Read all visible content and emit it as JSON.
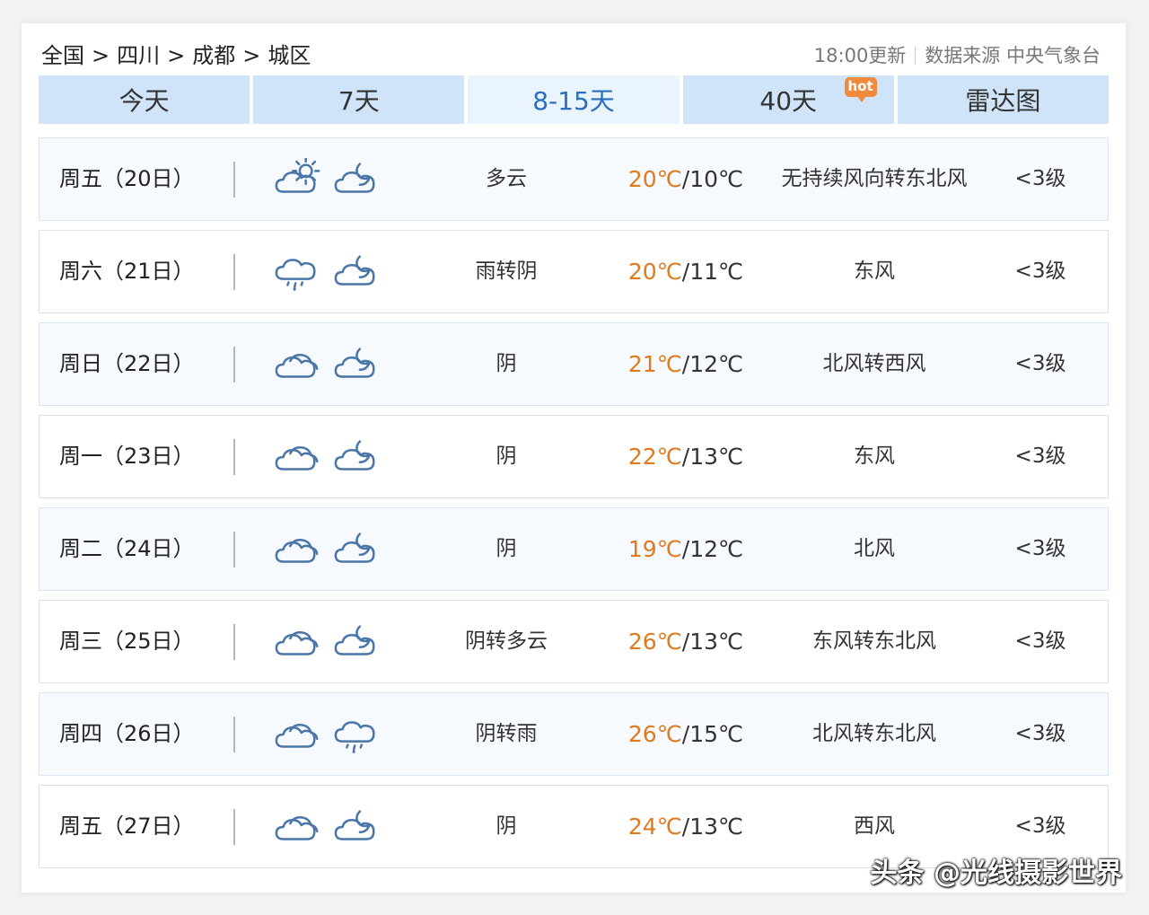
{
  "breadcrumb": [
    "全国",
    "四川",
    "成都",
    "城区"
  ],
  "breadcrumb_separator": ">",
  "update_time": "18:00更新",
  "source_label": "数据来源 中央气象台",
  "tabs": [
    {
      "label": "今天",
      "active": false
    },
    {
      "label": "7天",
      "active": false
    },
    {
      "label": "8-15天",
      "active": true
    },
    {
      "label": "40天",
      "active": false,
      "badge": "hot"
    },
    {
      "label": "雷达图",
      "active": false
    }
  ],
  "forecast": [
    {
      "day": "周五（20日）",
      "icons": [
        "partly-cloudy-day-icon",
        "cloudy-night-icon"
      ],
      "desc": "多云",
      "high": "20℃",
      "low": "10℃",
      "wind": "无持续风向转东北风",
      "level": "<3级"
    },
    {
      "day": "周六（21日）",
      "icons": [
        "rain-cloud-icon",
        "cloudy-night-icon"
      ],
      "desc": "雨转阴",
      "high": "20℃",
      "low": "11℃",
      "wind": "东风",
      "level": "<3级"
    },
    {
      "day": "周日（22日）",
      "icons": [
        "overcast-icon",
        "cloudy-night-icon"
      ],
      "desc": "阴",
      "high": "21℃",
      "low": "12℃",
      "wind": "北风转西风",
      "level": "<3级"
    },
    {
      "day": "周一（23日）",
      "icons": [
        "overcast-icon",
        "cloudy-night-icon"
      ],
      "desc": "阴",
      "high": "22℃",
      "low": "13℃",
      "wind": "东风",
      "level": "<3级"
    },
    {
      "day": "周二（24日）",
      "icons": [
        "overcast-icon",
        "cloudy-night-icon"
      ],
      "desc": "阴",
      "high": "19℃",
      "low": "12℃",
      "wind": "北风",
      "level": "<3级"
    },
    {
      "day": "周三（25日）",
      "icons": [
        "overcast-icon",
        "cloudy-night-icon"
      ],
      "desc": "阴转多云",
      "high": "26℃",
      "low": "13℃",
      "wind": "东风转东北风",
      "level": "<3级"
    },
    {
      "day": "周四（26日）",
      "icons": [
        "overcast-icon",
        "rain-cloud-icon"
      ],
      "desc": "阴转雨",
      "high": "26℃",
      "low": "15℃",
      "wind": "北风转东北风",
      "level": "<3级"
    },
    {
      "day": "周五（27日）",
      "icons": [
        "overcast-icon",
        "cloudy-night-icon"
      ],
      "desc": "阴",
      "high": "24℃",
      "low": "13℃",
      "wind": "西风",
      "level": "<3级"
    }
  ],
  "temp_separator": "/",
  "watermark": "头条 @光线摄影世界",
  "colors": {
    "tab_bg": "#cfe4f8",
    "tab_active_bg": "#eaf4fd",
    "tab_active_text": "#2a6ebd",
    "high_temp": "#e07a1e",
    "icon_stroke": "#4a76a8",
    "hot_badge": "#f08a3c"
  }
}
